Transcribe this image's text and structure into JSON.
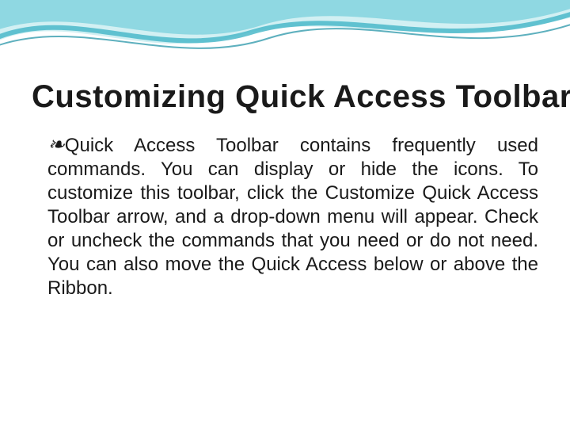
{
  "slide": {
    "title": "Customizing Quick Access Toolbar",
    "bullet_glyph": "་",
    "body": "Quick Access Toolbar contains frequently used commands. You can display or hide the icons. To customize this toolbar, click the Customize Quick Access Toolbar arrow, and a drop-down menu will appear. Check or uncheck the commands that you need or do not need. You can also move the Quick Access below or above the Ribbon."
  },
  "theme": {
    "wave_light": "#a8e0e8",
    "wave_mid": "#4bb8c9",
    "wave_dark": "#1a8fa3"
  }
}
